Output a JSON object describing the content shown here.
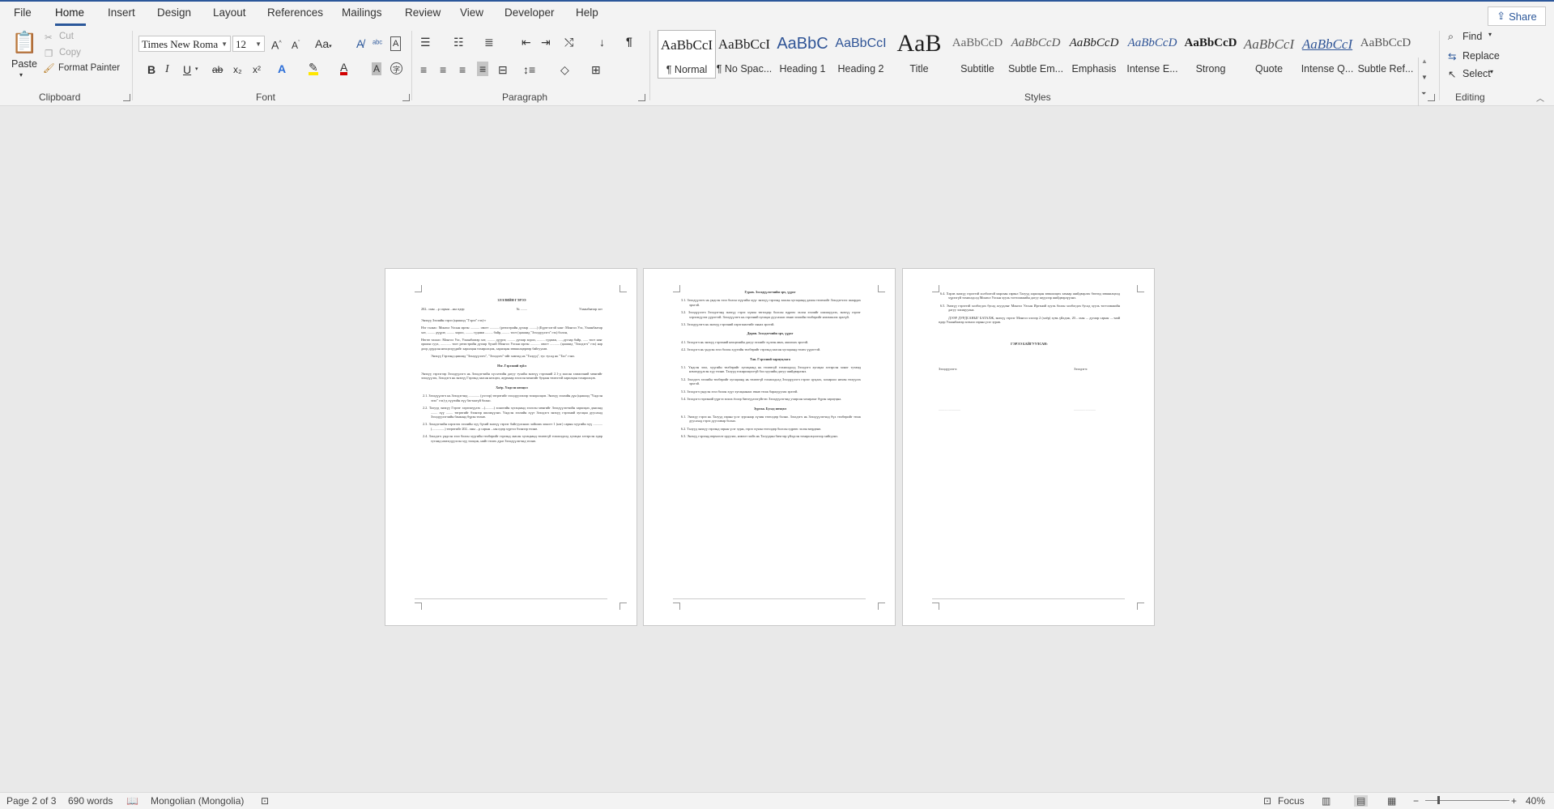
{
  "menu": {
    "tabs": [
      "File",
      "Home",
      "Insert",
      "Design",
      "Layout",
      "References",
      "Mailings",
      "Review",
      "View",
      "Developer",
      "Help"
    ],
    "share": "Share"
  },
  "clipboard": {
    "paste": "Paste",
    "cut": "Cut",
    "copy": "Copy",
    "format_painter": "Format Painter",
    "label": "Clipboard"
  },
  "font": {
    "name": "Times New Roma",
    "size": "12",
    "label": "Font",
    "bold": "B",
    "italic": "I",
    "underline": "U",
    "strike": "ab",
    "sub": "x₂",
    "sup": "x²",
    "case": "Aa"
  },
  "paragraph": {
    "label": "Paragraph"
  },
  "styles": {
    "label": "Styles",
    "items": [
      {
        "preview": "AaBbCcI",
        "name": "¶ Normal"
      },
      {
        "preview": "AaBbCcI",
        "name": "¶ No Spac..."
      },
      {
        "preview": "AaBbC",
        "name": "Heading 1"
      },
      {
        "preview": "AaBbCcI",
        "name": "Heading 2"
      },
      {
        "preview": "AaB",
        "name": "Title"
      },
      {
        "preview": "AaBbCcD",
        "name": "Subtitle"
      },
      {
        "preview": "AaBbCcD",
        "name": "Subtle Em..."
      },
      {
        "preview": "AaBbCcD",
        "name": "Emphasis"
      },
      {
        "preview": "AaBbCcD",
        "name": "Intense E..."
      },
      {
        "preview": "AaBbCcD",
        "name": "Strong"
      },
      {
        "preview": "AaBbCcI",
        "name": "Quote"
      },
      {
        "preview": "AaBbCcI",
        "name": "Intense Q..."
      },
      {
        "preview": "AaBbCcD",
        "name": "Subtle Ref..."
      }
    ]
  },
  "editing": {
    "label": "Editing",
    "find": "Find",
    "replace": "Replace",
    "select": "Select"
  },
  "pages": {
    "p1": {
      "title": "ЗЭЭЛИЙН ГЭРЭЭ",
      "date_line": "202.. оны ...р сарын ...ны өдөр",
      "num": "№ ........",
      "city": "Улаанбаатар хот",
      "p1": "Энэхүү Зээлийн гэрээ (цаашид \"Гэрээ\" гэх)-г",
      "p2": "Нэг талаас: Монгол Улсын иргэн ........... овогт ........... (регистрийн дугаар .........) (Бүртгэлтэй хаяг: Монгол Улс, Улаанбаатар хот, ......... дүүрэг, ......... хороо, ......... гудамж ......... байр, ......... тоот (цаашид \"Зээлдүүлэгч\" гэх) болон,",
      "p3": "Нөгөө талаас: Монгол Улс, Улаанбаатар хот, ......... дүүрэг, ......... дугаар хороо, ......... гудамж, ......дугаар байр, ...... тоот хаяг оршин суух, ............ тоот регистрийн дугаар бүхий Монгол Улсын иргэн ........... овогт ........... (цаашид \"Зээлдэгч\" гэх) нар доор дурдсан нөхцөлүүдийг харилцан тохиролцож, харилцан зөвшилцөрөөр байгуулав.",
      "p4": "Энэхүү Гэрээнд цаашид \"Зээлдүүлэгч\", \"Зээлдэгч\"-ийг хамтад нь \"Талууд\", тус тусад нь \"Тал\" гэнэ.",
      "h1": "Нэг. Гэрээний зүйл",
      "s1": "Энэхүү гэрээгээр Зээлдүүлэгч нь Зээлдэгчийн хүсэлтийн дагуу тухайн энэхүү гэрээний 2.1-д заасан хэмжээний мөнгийг зээлдүүлэх, Зээлдэгч нь энэхүү Гэрээнд заасан нөхцөл, журмаар зээлсэн мөнгийг буцаан төлөхтэй харилцан тохиролцов.",
      "h2": "Хоёр. Үндсэн нөхцөл",
      "s21": "2.1. Зээлдүүлэгч нь Зээлдэгчид ............. (үсгээр) төгрөгийг зээлдүүлэхээр тохиролцов. Энэхүү зээлийн дүн (цаашид \"Үндсэн зээл\" гэх)-д хүүгийн хүү багтаагүй болно.",
      "s22": "2.2. Талууд энэхүү Гэрээг хэрэгжүүлэх ...(..........) хоногийн хугацаанд зээлсэн мөнгийг Зээлдүүлэгчийн харилцах дансанд ........ хүү ........ төгрөгийг бэлнээр шилжүүлнэ. Үндсэн зээлийн хүүг Зээлдэгч энэхүү гэрээний хугацаа дуусахад Зээлдүүлэгчийн банканд бүрэн төлнө.",
      "s23": "2.3. Зээлдэгчийн хэрэглэх зээлийн хүү бүхий энэхүү гэрээг байгуулснаас хойших хоногт 1 (нэг) сарын хүүгийн хүү ........... (...............) төгрөгийг 202.. оны ...р сарын ...ны өдөр хүртэл бэлнээр төлнө.",
      "s24": "2.4. Зээлдэгч үндсэн зээл болон хүүгийн төлбөрийг гэрээнд заасан хугацаанд төлөөгүй тохиолдолд хугацаа хэтэрсэн өдөр тутамд нэмэгдүүлсэн хүү тооцож, нийт төлөх дүнг Зээлдүүлэгчид төлнө."
    },
    "p2": {
      "h3": "Гурав. Зээлдүүлэгчийн эрх, үүрэг",
      "s31": "3.1. Зээлдүүлэгч нь үндсэн зээл болон хүүгийн хүүг энэхүү гэрээнд заасан хугацаанд дахин төлөхийг Зээлдэгчээс шаардах эрхтэй.",
      "s32": "3.2. Зээлдүүлэгч Зээлдэгчид энэхүү гэрээ хүчин төгөлдөр болсон өдрөөс эхлэн зээлийг шилжүүлэх, энэхүү гэрээг хэрэгжүүлэх үүрэгтэй. Зээлдүүлэгч нь гэрээний хугацаа дуусахаас өмнө зээлийн төлбөрийг нэхэмжлэх эрхгүй.",
      "s33": "3.3. Зээлдүүлэгч нь энэхүү гэрээний хэрэгжилтийг хянах эрхтэй.",
      "h4": "Дөрөв. Зээлдэгчийн эрх, үүрэг",
      "s41": "4.1. Зээлдэгч нь энэхүү гэрээний нөхцөлийн дагуу зээлийг хүлээн авах, ашиглах эрхтэй.",
      "s42": "4.2. Зээлдэгч нь үндсэн зээл болон хүүгийн төлбөрийг гэрээнд заасан хугацаанд төлөх үүрэгтэй.",
      "h5": "Тав. Гэрээний хариуцлага",
      "s51": "5.1. Үндсэн зээл, хүүгийн төлбөрийг хугацаанд нь төлөөгүй тохиолдолд Зээлдэгч хугацаа хэтэрсэн хоног тутамд нэмэгдүүлсэн хүү төлнө. Талууд тохиролцоогүй бол хуулийн дагуу шийдвэрлэнэ.",
      "s52": "5.2. Зээлдэгч зээлийн төлбөрийг хугацаанд нь төлөөгүй тохиолдолд Зээлдүүлэгч гэрээг цуцлах, хохирлоо нөхөн төлүүлэх эрхтэй.",
      "s53": "5.3. Зээлдэгч үндсэн зээл болон хүүг хугацаанаас өмнө төлж барагдуулах эрхтэй.",
      "s54": "5.4. Зээлдэгч гэрээний үүргээ зохих ёсоор биелүүлээгүйгээс Зээлдүүлэгчид учирсан хохирлыг бүрэн хариуцна.",
      "h6": "Зургаа. Бусад нөхцөл",
      "s61": "6.1. Энэхүү гэрээ нь Талууд гарын үсэг зурснаар хүчин төгөлдөр болно. Зээлдэгч нь Зээлдүүлэгчид бүх төлбөрийг төлж дуусахад гэрээ дуусгавар болно.",
      "s62": "6.2. Талууд энэхүү гэрээнд гарын үсэг зурж, гэрээ хүчин төгөлдөр болсон өдрөөс эхлэн мөрдөнө.",
      "s63": "6.3. Энэхүү гэрээнд өөрчлөлт оруулах, нэмэлт хийх нь Талуудын бичгээр үйлдсэн тохиролцоогоор хийгдэнэ."
    },
    "p3": {
      "s64": "6.4. Хэрэв энэхүү гэрээтэй холбоотой маргаан гарвал Талууд харилцан зөвшилцөх замаар шийдвэрлэх бөгөөд зөвшилцөлд хүрээгүй тохиолдолд Монгол Улсын хууль тогтоомжийн дагуу шүүхээр шийдвэрлүүлнэ.",
      "s65": "6.5. Энэхүү гэрээтэй холбогдох бусад асуудлыг Монгол Улсын Иргэний хууль болон холбогдох бусад хууль тогтоомжийн дагуу зохицуулна.",
      "s66": "ДЭЭР ДУРДСАНЫГ БАТАЛЖ, энэхүү гэрээг Монгол хэлээр 2 (хоёр) хувь үйлдэж, 20... оны ... дугаар сарын ....-ний өдөр Улаанбаатар хотноо гарын үсэг зурав.",
      "sig_title": "ГЭРЭЭ БАЙГУУЛСАН:",
      "lender": "Зээлдүүлэгч:",
      "borrower": "Зээлдэгч:",
      "dots1": "..........................",
      "dots2": ".........................."
    }
  },
  "status": {
    "page": "Page 2 of 3",
    "words": "690 words",
    "language": "Mongolian (Mongolia)",
    "focus": "Focus",
    "zoom": "40%"
  }
}
